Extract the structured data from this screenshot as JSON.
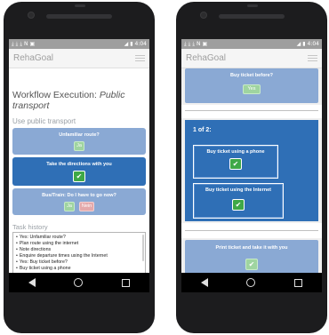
{
  "status": {
    "time": "4:04"
  },
  "app": {
    "title": "RehaGoal"
  },
  "left": {
    "workflow_prefix": "Workflow Execution: ",
    "workflow_name": "Public transport",
    "section": "Use public transport",
    "cards": {
      "unfamiliar": "Unfamiliar route?",
      "directions": "Take the directions with you",
      "bus": "Bus/Train: Do I have to go now?"
    },
    "buttons": {
      "ok": "Ja",
      "yes": "Ja",
      "no": "Nein"
    },
    "history_label": "Task history",
    "history": [
      "Yes: Unfamiliar route?",
      "Plan route using the internet",
      "Note directions",
      "Enquire departure times using the Internet",
      "Yes: Buy ticket before?",
      "Buy ticket using a phone"
    ]
  },
  "right": {
    "before_title": "Buy ticket before?",
    "before_yes": "Yes",
    "parallel_label": "1 of 2:",
    "phone_task": "Buy ticket using a phone",
    "internet_task": "Buy ticket using the Internet",
    "print_task": "Print ticket and take it with you"
  },
  "icons": {
    "check": "✔",
    "menu": "menu-icon"
  },
  "colors": {
    "status_bar": "#9e9e9e",
    "card_inactive": "#8aa9d4",
    "card_active": "#2f6fb6",
    "check_button": "#3fa847",
    "no_button": "#e4a9ab"
  }
}
